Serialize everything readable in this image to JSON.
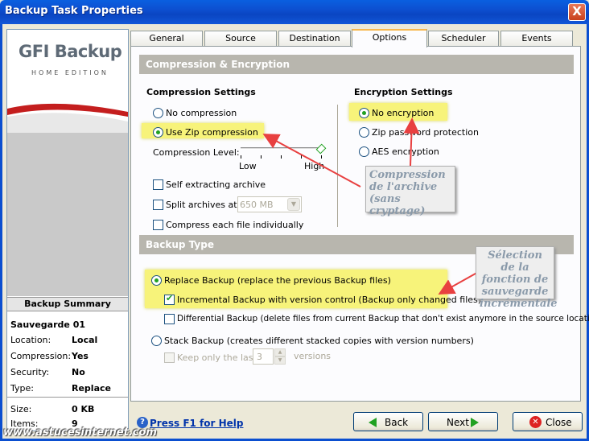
{
  "window": {
    "title": "Backup Task Properties",
    "close_glyph": "X"
  },
  "logo": {
    "brand": "GFI Backup",
    "edition": "HOME EDITION"
  },
  "summary": {
    "header": "Backup Summary",
    "name": "Sauvegarde 01",
    "rows": [
      {
        "key": "Location:",
        "value": "Local"
      },
      {
        "key": "Compression:",
        "value": "Yes"
      },
      {
        "key": "Security:",
        "value": "No"
      },
      {
        "key": "Type:",
        "value": "Replace"
      },
      {
        "key": "Size:",
        "value": "0 KB"
      },
      {
        "key": "Items:",
        "value": "9"
      }
    ]
  },
  "tabs": [
    {
      "label": "General",
      "active": false
    },
    {
      "label": "Source",
      "active": false
    },
    {
      "label": "Destination",
      "active": false
    },
    {
      "label": "Options",
      "active": true
    },
    {
      "label": "Scheduler",
      "active": false
    },
    {
      "label": "Events",
      "active": false
    }
  ],
  "compression": {
    "band": "Compression & Encryption",
    "settings_title": "Compression Settings",
    "no_compression": "No compression",
    "use_zip": "Use Zip compression",
    "selected": "use_zip",
    "level_label": "Compression Level:",
    "level_low": "Low",
    "level_high": "High",
    "level_value": 1.0,
    "self_extracting": "Self extracting archive",
    "self_extracting_checked": false,
    "split_archives": "Split archives at:",
    "split_checked": false,
    "split_value": "650 MB",
    "compress_each": "Compress each file individually",
    "compress_each_checked": false
  },
  "encryption": {
    "settings_title": "Encryption Settings",
    "no_encryption": "No encryption",
    "zip_password": "Zip password protection",
    "aes": "AES encryption",
    "selected": "no_encryption"
  },
  "backup_type": {
    "band": "Backup Type",
    "replace": "Replace Backup (replace the previous Backup files)",
    "incremental": "Incremental Backup with version control (Backup only changed files)",
    "incremental_checked": true,
    "differential": "Differential Backup (delete files from current Backup that don't exist anymore in the source location)",
    "differential_checked": false,
    "stack": "Stack Backup (creates different stacked copies with version numbers)",
    "keep_only": "Keep only the last",
    "keep_value": "3",
    "versions": "versions",
    "selected": "replace"
  },
  "annotations": {
    "note1": "Compression de l'archive (sans cryptage)",
    "note2": "Sélection de la fonction de sauvegarde incrémentale",
    "arrow_color": "#e84040",
    "highlight_color": "#f7f37a"
  },
  "footer": {
    "help_icon": "?",
    "help": "Press F1 for Help",
    "back": "Back",
    "next": "Next",
    "close": "Close",
    "close_icon_glyph": "✕",
    "watermark": "www.astucesinternet.com"
  },
  "colors": {
    "titlebar": "#0a5fe0",
    "accent_green": "#21a121",
    "band_gray": "#b8b6ae"
  }
}
